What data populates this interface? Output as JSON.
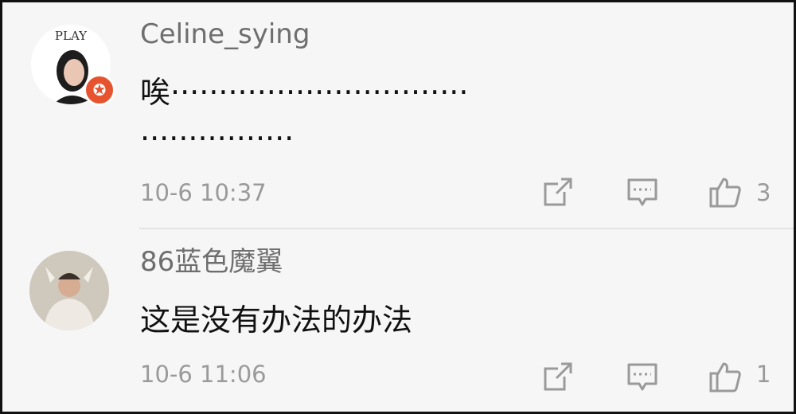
{
  "comments": [
    {
      "username": "Celine_sying",
      "avatar_text": "PLAY",
      "verified_icon": "star-badge-icon",
      "text": "唉·······························\n················",
      "timestamp": "10-6 10:37",
      "like_count": "3"
    },
    {
      "username": "86蓝色魔翼",
      "text": "这是没有办法的办法",
      "timestamp": "10-6 11:06",
      "like_count": "1"
    }
  ],
  "colors": {
    "background": "#f6f6f6",
    "username": "#6e6e6e",
    "secondary_text": "#9a9a9a",
    "badge": "#e8532f"
  }
}
